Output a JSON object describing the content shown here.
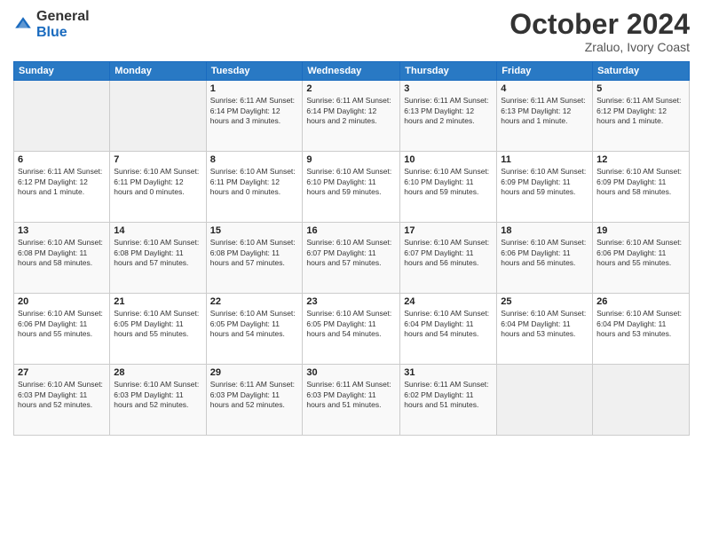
{
  "header": {
    "month_year": "October 2024",
    "location": "Zraluo, Ivory Coast"
  },
  "columns": [
    "Sunday",
    "Monday",
    "Tuesday",
    "Wednesday",
    "Thursday",
    "Friday",
    "Saturday"
  ],
  "weeks": [
    [
      {
        "day": "",
        "info": ""
      },
      {
        "day": "",
        "info": ""
      },
      {
        "day": "1",
        "info": "Sunrise: 6:11 AM\nSunset: 6:14 PM\nDaylight: 12 hours\nand 3 minutes."
      },
      {
        "day": "2",
        "info": "Sunrise: 6:11 AM\nSunset: 6:14 PM\nDaylight: 12 hours\nand 2 minutes."
      },
      {
        "day": "3",
        "info": "Sunrise: 6:11 AM\nSunset: 6:13 PM\nDaylight: 12 hours\nand 2 minutes."
      },
      {
        "day": "4",
        "info": "Sunrise: 6:11 AM\nSunset: 6:13 PM\nDaylight: 12 hours\nand 1 minute."
      },
      {
        "day": "5",
        "info": "Sunrise: 6:11 AM\nSunset: 6:12 PM\nDaylight: 12 hours\nand 1 minute."
      }
    ],
    [
      {
        "day": "6",
        "info": "Sunrise: 6:11 AM\nSunset: 6:12 PM\nDaylight: 12 hours\nand 1 minute."
      },
      {
        "day": "7",
        "info": "Sunrise: 6:10 AM\nSunset: 6:11 PM\nDaylight: 12 hours\nand 0 minutes."
      },
      {
        "day": "8",
        "info": "Sunrise: 6:10 AM\nSunset: 6:11 PM\nDaylight: 12 hours\nand 0 minutes."
      },
      {
        "day": "9",
        "info": "Sunrise: 6:10 AM\nSunset: 6:10 PM\nDaylight: 11 hours\nand 59 minutes."
      },
      {
        "day": "10",
        "info": "Sunrise: 6:10 AM\nSunset: 6:10 PM\nDaylight: 11 hours\nand 59 minutes."
      },
      {
        "day": "11",
        "info": "Sunrise: 6:10 AM\nSunset: 6:09 PM\nDaylight: 11 hours\nand 59 minutes."
      },
      {
        "day": "12",
        "info": "Sunrise: 6:10 AM\nSunset: 6:09 PM\nDaylight: 11 hours\nand 58 minutes."
      }
    ],
    [
      {
        "day": "13",
        "info": "Sunrise: 6:10 AM\nSunset: 6:08 PM\nDaylight: 11 hours\nand 58 minutes."
      },
      {
        "day": "14",
        "info": "Sunrise: 6:10 AM\nSunset: 6:08 PM\nDaylight: 11 hours\nand 57 minutes."
      },
      {
        "day": "15",
        "info": "Sunrise: 6:10 AM\nSunset: 6:08 PM\nDaylight: 11 hours\nand 57 minutes."
      },
      {
        "day": "16",
        "info": "Sunrise: 6:10 AM\nSunset: 6:07 PM\nDaylight: 11 hours\nand 57 minutes."
      },
      {
        "day": "17",
        "info": "Sunrise: 6:10 AM\nSunset: 6:07 PM\nDaylight: 11 hours\nand 56 minutes."
      },
      {
        "day": "18",
        "info": "Sunrise: 6:10 AM\nSunset: 6:06 PM\nDaylight: 11 hours\nand 56 minutes."
      },
      {
        "day": "19",
        "info": "Sunrise: 6:10 AM\nSunset: 6:06 PM\nDaylight: 11 hours\nand 55 minutes."
      }
    ],
    [
      {
        "day": "20",
        "info": "Sunrise: 6:10 AM\nSunset: 6:06 PM\nDaylight: 11 hours\nand 55 minutes."
      },
      {
        "day": "21",
        "info": "Sunrise: 6:10 AM\nSunset: 6:05 PM\nDaylight: 11 hours\nand 55 minutes."
      },
      {
        "day": "22",
        "info": "Sunrise: 6:10 AM\nSunset: 6:05 PM\nDaylight: 11 hours\nand 54 minutes."
      },
      {
        "day": "23",
        "info": "Sunrise: 6:10 AM\nSunset: 6:05 PM\nDaylight: 11 hours\nand 54 minutes."
      },
      {
        "day": "24",
        "info": "Sunrise: 6:10 AM\nSunset: 6:04 PM\nDaylight: 11 hours\nand 54 minutes."
      },
      {
        "day": "25",
        "info": "Sunrise: 6:10 AM\nSunset: 6:04 PM\nDaylight: 11 hours\nand 53 minutes."
      },
      {
        "day": "26",
        "info": "Sunrise: 6:10 AM\nSunset: 6:04 PM\nDaylight: 11 hours\nand 53 minutes."
      }
    ],
    [
      {
        "day": "27",
        "info": "Sunrise: 6:10 AM\nSunset: 6:03 PM\nDaylight: 11 hours\nand 52 minutes."
      },
      {
        "day": "28",
        "info": "Sunrise: 6:10 AM\nSunset: 6:03 PM\nDaylight: 11 hours\nand 52 minutes."
      },
      {
        "day": "29",
        "info": "Sunrise: 6:11 AM\nSunset: 6:03 PM\nDaylight: 11 hours\nand 52 minutes."
      },
      {
        "day": "30",
        "info": "Sunrise: 6:11 AM\nSunset: 6:03 PM\nDaylight: 11 hours\nand 51 minutes."
      },
      {
        "day": "31",
        "info": "Sunrise: 6:11 AM\nSunset: 6:02 PM\nDaylight: 11 hours\nand 51 minutes."
      },
      {
        "day": "",
        "info": ""
      },
      {
        "day": "",
        "info": ""
      }
    ]
  ]
}
